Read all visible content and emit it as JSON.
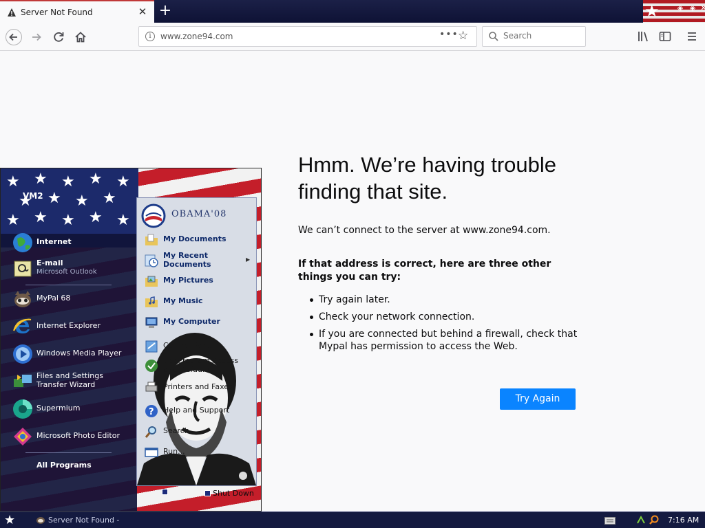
{
  "browser": {
    "tab": {
      "title": "Server Not Found"
    },
    "url": "www.zone94.com",
    "search": {
      "placeholder": "Search"
    }
  },
  "error_page": {
    "title": "Hmm. We’re having trouble finding that site.",
    "description": "We can’t connect to the server at www.zone94.com.",
    "subtitle": "If that address is correct, here are three other things you can try:",
    "suggestions": [
      "Try again later.",
      "Check your network connection.",
      "If you are connected but behind a firewall, check that Mypal has permission to access the Web."
    ],
    "button_label": "Try Again",
    "accent": "#0a84ff"
  },
  "start_menu": {
    "user": "VM2",
    "pinned": [
      {
        "label": "Internet",
        "icon": "globe-icon"
      },
      {
        "label": "E-mail",
        "sub": "Microsoft Outlook",
        "icon": "email-icon"
      }
    ],
    "programs": [
      {
        "label": "MyPal 68",
        "icon": "mypal-icon"
      },
      {
        "label": "Internet Explorer",
        "icon": "ie-icon"
      },
      {
        "label": "Windows Media Player",
        "icon": "media-player-icon"
      },
      {
        "label": "Files and Settings Transfer Wizard",
        "icon": "transfer-wizard-icon"
      },
      {
        "label": "Supermium",
        "icon": "supermium-icon"
      },
      {
        "label": "Microsoft Photo Editor",
        "icon": "photo-editor-icon"
      }
    ],
    "all_programs": "All Programs",
    "logo_text": "OBAMA'08",
    "places": [
      {
        "label": "My Documents",
        "icon": "documents-folder-icon"
      },
      {
        "label": "My Recent Documents",
        "icon": "recent-documents-icon"
      },
      {
        "label": "My Pictures",
        "icon": "pictures-folder-icon"
      },
      {
        "label": "My Music",
        "icon": "music-folder-icon"
      },
      {
        "label": "My Computer",
        "icon": "computer-icon"
      }
    ],
    "system": [
      {
        "label": "Control Panel",
        "icon": "control-panel-icon"
      },
      {
        "label": "Set Program Access and Defaults",
        "icon": "program-defaults-icon"
      },
      {
        "label": "Printers and Faxes",
        "icon": "printer-icon"
      },
      {
        "label": "Help and Support",
        "icon": "help-icon"
      },
      {
        "label": "Search",
        "icon": "search-icon"
      },
      {
        "label": "Run...",
        "icon": "run-icon"
      }
    ],
    "shutdown": "Shut Down"
  },
  "taskbar": {
    "task_label": "Server Not Found - ...",
    "clock": "7:16 AM"
  }
}
